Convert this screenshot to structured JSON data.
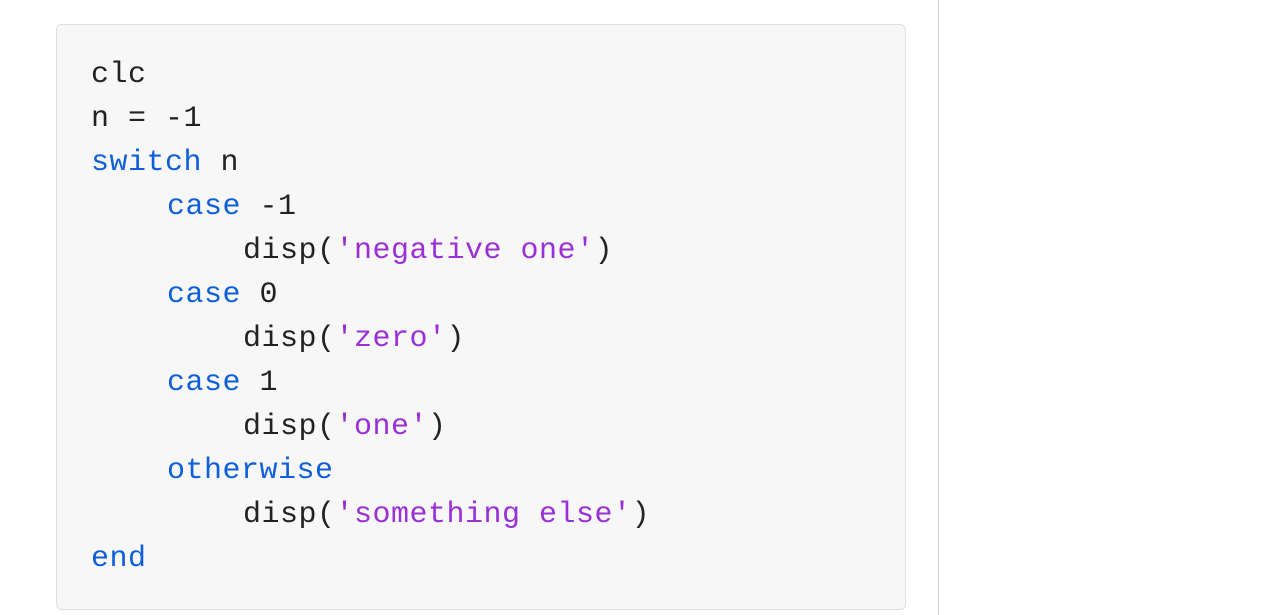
{
  "code": {
    "line1": "clc",
    "line2_left": "n = ",
    "line2_right": "-1",
    "line3_kw": "switch",
    "line3_rest": " n",
    "line4_kw": "case",
    "line4_rest": " -1",
    "line5_pre": "disp(",
    "line5_str": "'negative one'",
    "line5_post": ")",
    "line6_kw": "case",
    "line6_rest": " 0",
    "line7_pre": "disp(",
    "line7_str": "'zero'",
    "line7_post": ")",
    "line8_kw": "case",
    "line8_rest": " 1",
    "line9_pre": "disp(",
    "line9_str": "'one'",
    "line9_post": ")",
    "line10_kw": "otherwise",
    "line11_pre": "disp(",
    "line11_str": "'something else'",
    "line11_post": ")",
    "line12_kw": "end"
  }
}
